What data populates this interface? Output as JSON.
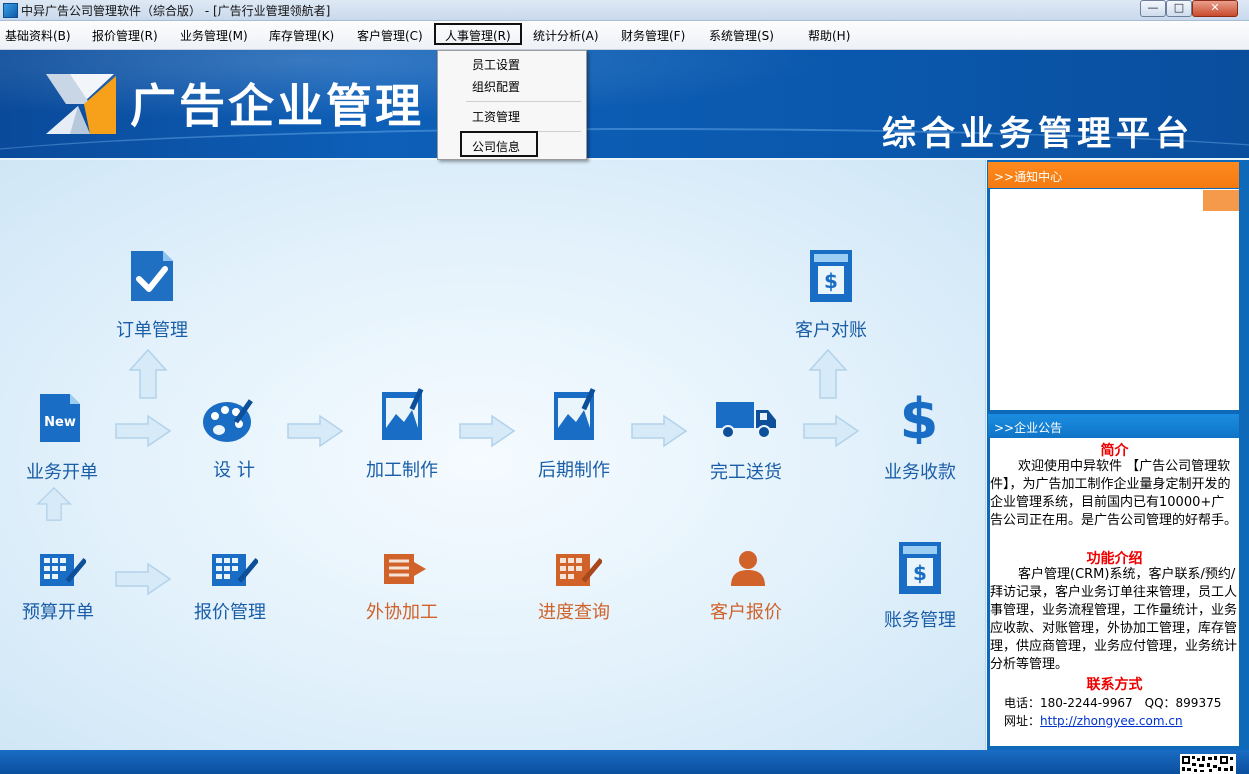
{
  "window": {
    "title": "中异广告公司管理软件（综合版） - [广告行业管理领航者]",
    "min": "—",
    "max": "□",
    "close": "✕"
  },
  "menu": [
    "基础资料(B)",
    "报价管理(R)",
    "业务管理(M)",
    "库存管理(K)",
    "客户管理(C)",
    "人事管理(R)",
    "统计分析(A)",
    "财务管理(F)",
    "系统管理(S)",
    "帮助(H)"
  ],
  "dropdown": {
    "items": [
      "员工设置",
      "组织配置",
      "工资管理",
      "公司信息"
    ]
  },
  "banner": {
    "title": "广告企业管理",
    "subtitle": "综合业务管理平台"
  },
  "flow": {
    "order": "订单管理",
    "business_open": "业务开单",
    "design": "设 计",
    "processing": "加工制作",
    "post": "后期制作",
    "delivery": "完工送货",
    "reconcile": "客户对账",
    "collection": "业务收款",
    "budget": "预算开单",
    "quote": "报价管理",
    "outsource": "外协加工",
    "progress": "进度查询",
    "cust_quote": "客户报价",
    "accounts": "账务管理",
    "new_badge": "New"
  },
  "panel": {
    "notice_title": ">>通知中心",
    "announce_title": ">>企业公告",
    "intro_title": "简介",
    "intro_text": "欢迎使用中异软件 【广告公司管理软件】，为广告加工制作企业量身定制开发的企业管理系统，目前国内已有10000+广告公司正在用。是广告公司管理的好帮手。",
    "features_title": "功能介绍",
    "features_text": "客户管理(CRM)系统，客户联系/预约/拜访记录，客户业务订单往来管理，员工人事管理，业务流程管理，工作量统计，业务应收款、对账管理，外协加工管理，库存管理，供应商管理，业务应付管理，业务统计分析等管理。",
    "contact_title": "联系方式",
    "phone_line": "电话：180-2244-9967　QQ：899375",
    "site_label": "网址：",
    "site_url": "http://zhongyee.com.cn"
  },
  "colors": {
    "banner": "#0d5fb8",
    "accent_orange": "#f37a10",
    "label_blue": "#1b5ea8",
    "label_orange": "#d0622a",
    "title_red": "#e00000"
  }
}
